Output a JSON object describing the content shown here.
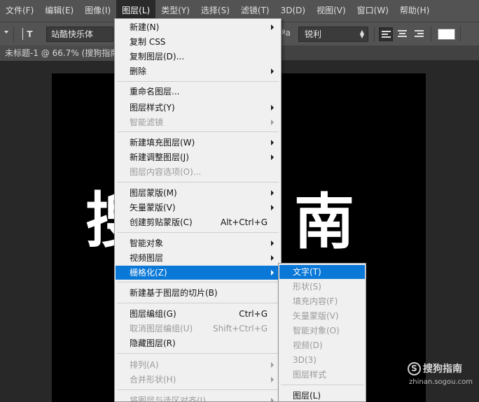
{
  "menubar": {
    "items": [
      "文件(F)",
      "编辑(E)",
      "图像(I)",
      "图层(L)",
      "类型(Y)",
      "选择(S)",
      "滤镜(T)",
      "3D(D)",
      "视图(V)",
      "窗口(W)",
      "帮助(H)"
    ],
    "active_index": 3
  },
  "options": {
    "font_family": "站酷快乐体",
    "aa_label": "ªa",
    "antialias": "锐利",
    "text_color": "#ffffff"
  },
  "document": {
    "tab_title": "未标题-1 @ 66.7% (搜狗指南"
  },
  "canvas": {
    "visible_chars": [
      "搜",
      "南"
    ]
  },
  "watermark": {
    "icon": "sogou-s-icon",
    "brand": "搜狗指南",
    "url": "zhinan.sogou.com"
  },
  "layer_menu": {
    "items": [
      {
        "label": "新建(N)",
        "submenu": true
      },
      {
        "label": "复制 CSS"
      },
      {
        "label": "复制图层(D)..."
      },
      {
        "label": "删除",
        "submenu": true
      },
      {
        "label": "重命名图层..."
      },
      {
        "label": "图层样式(Y)",
        "submenu": true
      },
      {
        "label": "智能滤镜",
        "submenu": true,
        "disabled": true
      },
      {
        "label": "新建填充图层(W)",
        "submenu": true
      },
      {
        "label": "新建调整图层(J)",
        "submenu": true
      },
      {
        "label": "图层内容选项(O)...",
        "disabled": true
      },
      {
        "label": "图层蒙版(M)",
        "submenu": true
      },
      {
        "label": "矢量蒙版(V)",
        "submenu": true
      },
      {
        "label": "创建剪贴蒙版(C)",
        "shortcut": "Alt+Ctrl+G"
      },
      {
        "label": "智能对象",
        "submenu": true
      },
      {
        "label": "视频图层",
        "submenu": true
      },
      {
        "label": "栅格化(Z)",
        "submenu": true,
        "highlighted": true
      },
      {
        "label": "新建基于图层的切片(B)"
      },
      {
        "label": "图层编组(G)",
        "shortcut": "Ctrl+G"
      },
      {
        "label": "取消图层编组(U)",
        "shortcut": "Shift+Ctrl+G",
        "disabled": true
      },
      {
        "label": "隐藏图层(R)"
      },
      {
        "label": "排列(A)",
        "submenu": true,
        "disabled": true
      },
      {
        "label": "合并形状(H)",
        "submenu": true,
        "disabled": true
      },
      {
        "label": "将图层与选区对齐(I)",
        "submenu": true,
        "disabled": true
      }
    ]
  },
  "rasterize_submenu": {
    "items": [
      {
        "label": "文字(T)",
        "highlighted": true
      },
      {
        "label": "形状(S)",
        "disabled": true
      },
      {
        "label": "填充内容(F)",
        "disabled": true
      },
      {
        "label": "矢量蒙版(V)",
        "disabled": true
      },
      {
        "label": "智能对象(O)",
        "disabled": true
      },
      {
        "label": "视频(D)",
        "disabled": true
      },
      {
        "label": "3D(3)",
        "disabled": true
      },
      {
        "label": "图层样式",
        "disabled": true
      },
      {
        "label": "图层(L)"
      }
    ]
  }
}
